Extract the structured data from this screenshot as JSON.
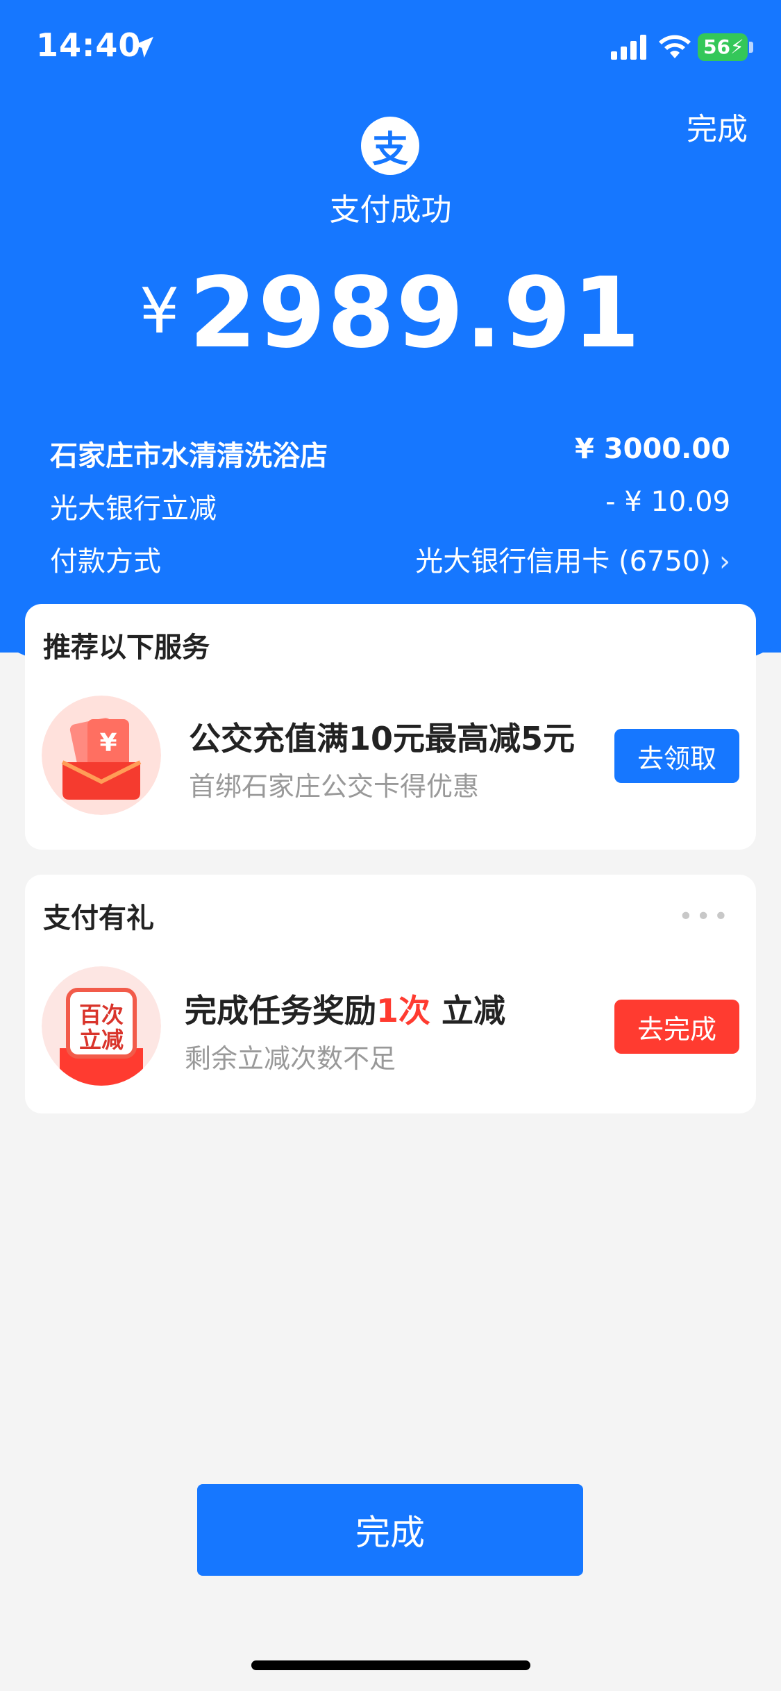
{
  "status_bar": {
    "time": "14:40",
    "battery": "56"
  },
  "header": {
    "done_label": "完成",
    "logo_glyph": "支",
    "title": "支付成功",
    "currency": "¥",
    "amount": "2989.91"
  },
  "details": {
    "merchant": "石家庄市水清清洗浴店",
    "merchant_amount": "¥ 3000.00",
    "discount_label": "光大银行立减",
    "discount_amount": "- ¥ 10.09",
    "payment_label": "付款方式",
    "payment_method": "光大银行信用卡 (6750)"
  },
  "recommend": {
    "title": "推荐以下服务",
    "main": "公交充值满10元最高减5元",
    "sub": "首绑石家庄公交卡得优惠",
    "button": "去领取"
  },
  "reward": {
    "title": "支付有礼",
    "main_prefix": "完成任务奖励",
    "main_highlight": "1次",
    "main_suffix": " 立减",
    "sub": "剩余立减次数不足",
    "button": "去完成",
    "badge_line1": "百次",
    "badge_line2": "立减"
  },
  "footer": {
    "done_label": "完成"
  },
  "colors": {
    "primary": "#1677ff",
    "danger": "#ff3b30",
    "background": "#f4f4f4"
  }
}
